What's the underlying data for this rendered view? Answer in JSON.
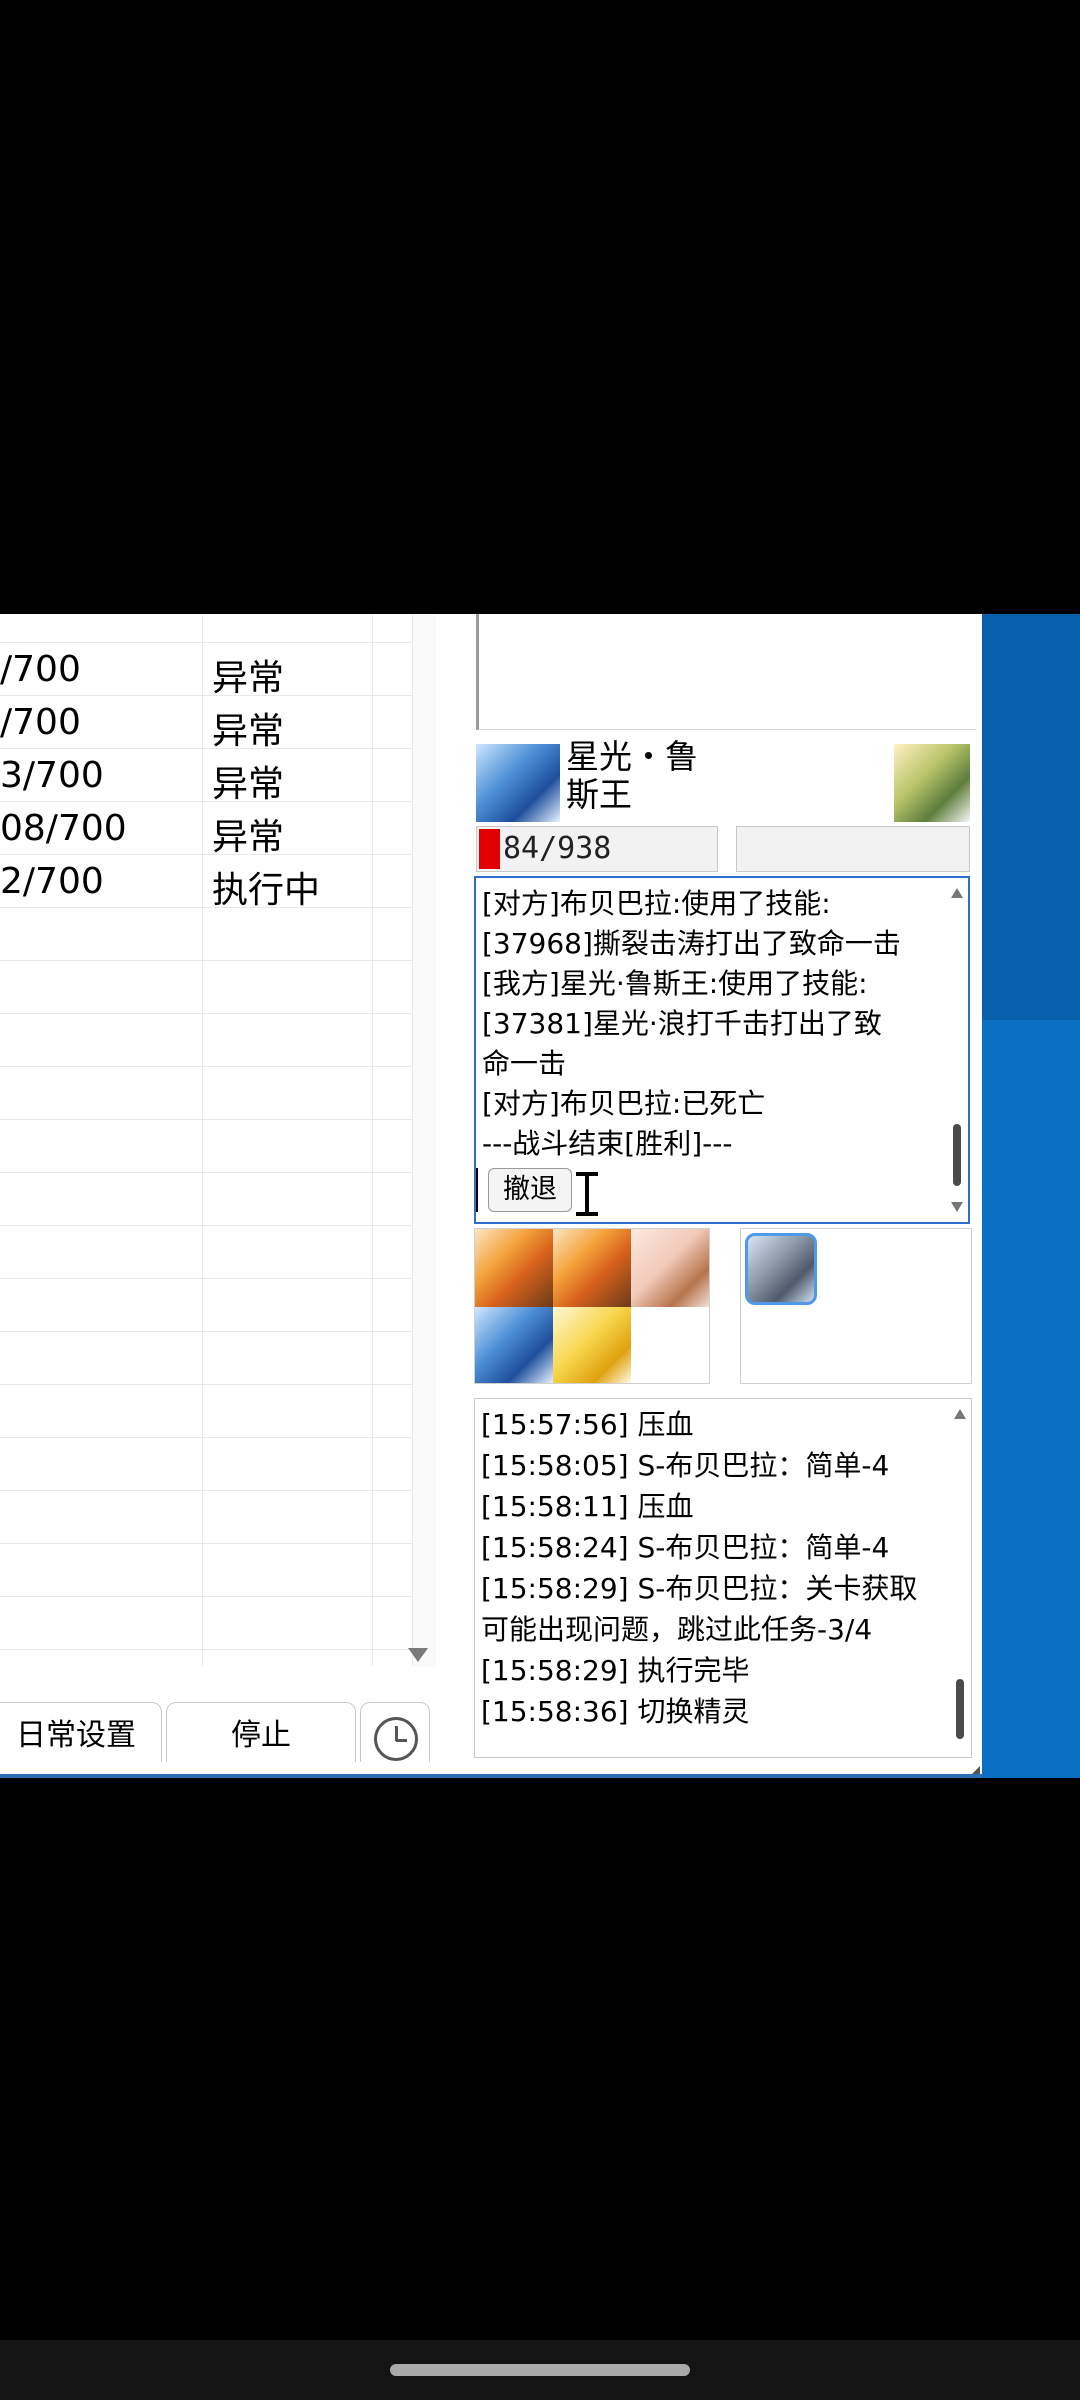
{
  "task_table": {
    "rows": [
      {
        "progress": "/700",
        "status": "异常"
      },
      {
        "progress": "/700",
        "status": "异常"
      },
      {
        "progress": "3/700",
        "status": "异常"
      },
      {
        "progress": "08/700",
        "status": "异常"
      },
      {
        "progress": "2/700",
        "status": "执行中"
      }
    ]
  },
  "buttons": {
    "daily_settings": "日常设置",
    "stop": "停止"
  },
  "battle": {
    "pet_name_line1": "星光・鲁",
    "pet_name_line2": "斯王",
    "hp_text": "84/938",
    "hp_fraction": 0.09,
    "log_lines": [
      "[对方]布贝巴拉:使用了技能:",
      "[37968]撕裂击涛打出了致命一击",
      "[我方]星光·鲁斯王:使用了技能:",
      "[37381]星光·浪打千击打出了致",
      "命一击",
      "[对方]布贝巴拉:已死亡",
      "---战斗结束[胜利]---"
    ],
    "retreat_label": "撤退"
  },
  "task_log": {
    "lines": [
      "[15:57:56] 压血",
      "[15:58:05] S-布贝巴拉：简单-4",
      "[15:58:11] 压血",
      "[15:58:24] S-布贝巴拉：简单-4",
      "[15:58:29] S-布贝巴拉：关卡获取",
      "可能出现问题，跳过此任务-3/4",
      "[15:58:29]  执行完毕",
      "[15:58:36] 切换精灵"
    ]
  },
  "colors": {
    "accent_blue": "#2f6fcc",
    "side_blue": "#0a6fc3",
    "hp_red": "#e00000"
  },
  "icons": {
    "clock": "clock-icon",
    "cursor": "text-cursor-icon"
  }
}
